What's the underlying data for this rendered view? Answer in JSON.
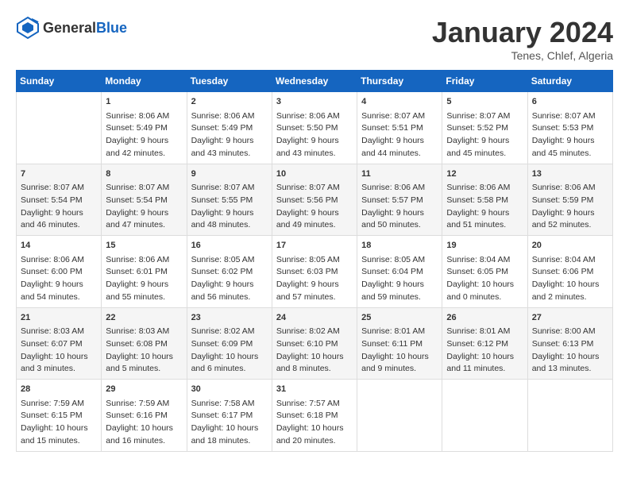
{
  "header": {
    "logo_general": "General",
    "logo_blue": "Blue",
    "title": "January 2024",
    "subtitle": "Tenes, Chlef, Algeria"
  },
  "days_header": [
    "Sunday",
    "Monday",
    "Tuesday",
    "Wednesday",
    "Thursday",
    "Friday",
    "Saturday"
  ],
  "weeks": [
    [
      {
        "day": "",
        "content": ""
      },
      {
        "day": "1",
        "content": "Sunrise: 8:06 AM\nSunset: 5:49 PM\nDaylight: 9 hours\nand 42 minutes."
      },
      {
        "day": "2",
        "content": "Sunrise: 8:06 AM\nSunset: 5:49 PM\nDaylight: 9 hours\nand 43 minutes."
      },
      {
        "day": "3",
        "content": "Sunrise: 8:06 AM\nSunset: 5:50 PM\nDaylight: 9 hours\nand 43 minutes."
      },
      {
        "day": "4",
        "content": "Sunrise: 8:07 AM\nSunset: 5:51 PM\nDaylight: 9 hours\nand 44 minutes."
      },
      {
        "day": "5",
        "content": "Sunrise: 8:07 AM\nSunset: 5:52 PM\nDaylight: 9 hours\nand 45 minutes."
      },
      {
        "day": "6",
        "content": "Sunrise: 8:07 AM\nSunset: 5:53 PM\nDaylight: 9 hours\nand 45 minutes."
      }
    ],
    [
      {
        "day": "7",
        "content": "Sunrise: 8:07 AM\nSunset: 5:54 PM\nDaylight: 9 hours\nand 46 minutes."
      },
      {
        "day": "8",
        "content": "Sunrise: 8:07 AM\nSunset: 5:54 PM\nDaylight: 9 hours\nand 47 minutes."
      },
      {
        "day": "9",
        "content": "Sunrise: 8:07 AM\nSunset: 5:55 PM\nDaylight: 9 hours\nand 48 minutes."
      },
      {
        "day": "10",
        "content": "Sunrise: 8:07 AM\nSunset: 5:56 PM\nDaylight: 9 hours\nand 49 minutes."
      },
      {
        "day": "11",
        "content": "Sunrise: 8:06 AM\nSunset: 5:57 PM\nDaylight: 9 hours\nand 50 minutes."
      },
      {
        "day": "12",
        "content": "Sunrise: 8:06 AM\nSunset: 5:58 PM\nDaylight: 9 hours\nand 51 minutes."
      },
      {
        "day": "13",
        "content": "Sunrise: 8:06 AM\nSunset: 5:59 PM\nDaylight: 9 hours\nand 52 minutes."
      }
    ],
    [
      {
        "day": "14",
        "content": "Sunrise: 8:06 AM\nSunset: 6:00 PM\nDaylight: 9 hours\nand 54 minutes."
      },
      {
        "day": "15",
        "content": "Sunrise: 8:06 AM\nSunset: 6:01 PM\nDaylight: 9 hours\nand 55 minutes."
      },
      {
        "day": "16",
        "content": "Sunrise: 8:05 AM\nSunset: 6:02 PM\nDaylight: 9 hours\nand 56 minutes."
      },
      {
        "day": "17",
        "content": "Sunrise: 8:05 AM\nSunset: 6:03 PM\nDaylight: 9 hours\nand 57 minutes."
      },
      {
        "day": "18",
        "content": "Sunrise: 8:05 AM\nSunset: 6:04 PM\nDaylight: 9 hours\nand 59 minutes."
      },
      {
        "day": "19",
        "content": "Sunrise: 8:04 AM\nSunset: 6:05 PM\nDaylight: 10 hours\nand 0 minutes."
      },
      {
        "day": "20",
        "content": "Sunrise: 8:04 AM\nSunset: 6:06 PM\nDaylight: 10 hours\nand 2 minutes."
      }
    ],
    [
      {
        "day": "21",
        "content": "Sunrise: 8:03 AM\nSunset: 6:07 PM\nDaylight: 10 hours\nand 3 minutes."
      },
      {
        "day": "22",
        "content": "Sunrise: 8:03 AM\nSunset: 6:08 PM\nDaylight: 10 hours\nand 5 minutes."
      },
      {
        "day": "23",
        "content": "Sunrise: 8:02 AM\nSunset: 6:09 PM\nDaylight: 10 hours\nand 6 minutes."
      },
      {
        "day": "24",
        "content": "Sunrise: 8:02 AM\nSunset: 6:10 PM\nDaylight: 10 hours\nand 8 minutes."
      },
      {
        "day": "25",
        "content": "Sunrise: 8:01 AM\nSunset: 6:11 PM\nDaylight: 10 hours\nand 9 minutes."
      },
      {
        "day": "26",
        "content": "Sunrise: 8:01 AM\nSunset: 6:12 PM\nDaylight: 10 hours\nand 11 minutes."
      },
      {
        "day": "27",
        "content": "Sunrise: 8:00 AM\nSunset: 6:13 PM\nDaylight: 10 hours\nand 13 minutes."
      }
    ],
    [
      {
        "day": "28",
        "content": "Sunrise: 7:59 AM\nSunset: 6:15 PM\nDaylight: 10 hours\nand 15 minutes."
      },
      {
        "day": "29",
        "content": "Sunrise: 7:59 AM\nSunset: 6:16 PM\nDaylight: 10 hours\nand 16 minutes."
      },
      {
        "day": "30",
        "content": "Sunrise: 7:58 AM\nSunset: 6:17 PM\nDaylight: 10 hours\nand 18 minutes."
      },
      {
        "day": "31",
        "content": "Sunrise: 7:57 AM\nSunset: 6:18 PM\nDaylight: 10 hours\nand 20 minutes."
      },
      {
        "day": "",
        "content": ""
      },
      {
        "day": "",
        "content": ""
      },
      {
        "day": "",
        "content": ""
      }
    ]
  ]
}
